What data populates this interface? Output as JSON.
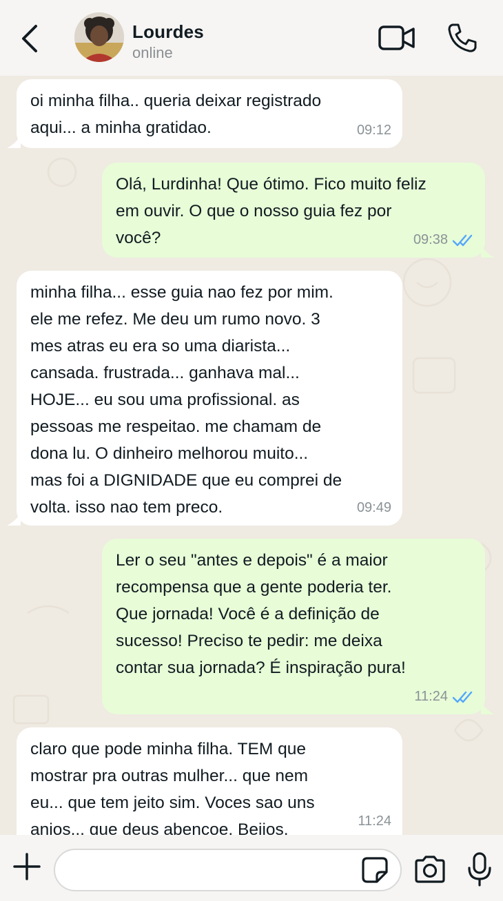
{
  "header": {
    "contact_name": "Lourdes",
    "status": "online",
    "back_icon": "chevron-left-icon",
    "video_icon": "video-camera-icon",
    "call_icon": "phone-icon"
  },
  "messages": [
    {
      "direction": "incoming",
      "text": "oi minha filha.. queria deixar registrado\naqui... a minha gratidao.",
      "time": "09:12"
    },
    {
      "direction": "outgoing",
      "text": "Olá, Lurdinha! Que ótimo. Fico muito feliz\nem ouvir. O que o nosso guia fez por\nvocê?",
      "time": "09:38",
      "read": true
    },
    {
      "direction": "incoming",
      "text": "minha filha... esse guia nao fez por mim.\nele me refez. Me deu um rumo novo. 3\nmes atras eu era so uma diarista...\ncansada. frustrada... ganhava mal...\nHOJE... eu sou uma profissional. as\npessoas me respeitao. me chamam de\ndona lu. O dinheiro melhorou muito...\nmas foi a DIGNIDADE que eu comprei de\nvolta. isso nao tem preco.",
      "time": "09:49"
    },
    {
      "direction": "outgoing",
      "text": "Ler o seu \"antes e depois\" é a maior\nrecompensa que a gente poderia ter.\nQue jornada! Você é a definição de\nsucesso! Preciso te pedir: me deixa\ncontar sua jornada? É inspiração pura!",
      "time": "11:24",
      "read": true
    },
    {
      "direction": "incoming",
      "text": "claro que pode minha filha. TEM que\nmostrar pra outras mulher... que nem\neu... que tem jeito sim. Voces sao uns\nanjos... que deus abençoe. Beijos.",
      "time": "11:24"
    }
  ],
  "input_bar": {
    "placeholder": "",
    "value": "",
    "icons": [
      "plus-icon",
      "sticker-icon",
      "camera-icon",
      "microphone-icon"
    ]
  },
  "colors": {
    "incoming_bubble": "#ffffff",
    "outgoing_bubble": "#e7fcd7",
    "chat_background": "#efeae2",
    "read_ticks": "#53a6fd",
    "timestamp": "#8a9296"
  }
}
